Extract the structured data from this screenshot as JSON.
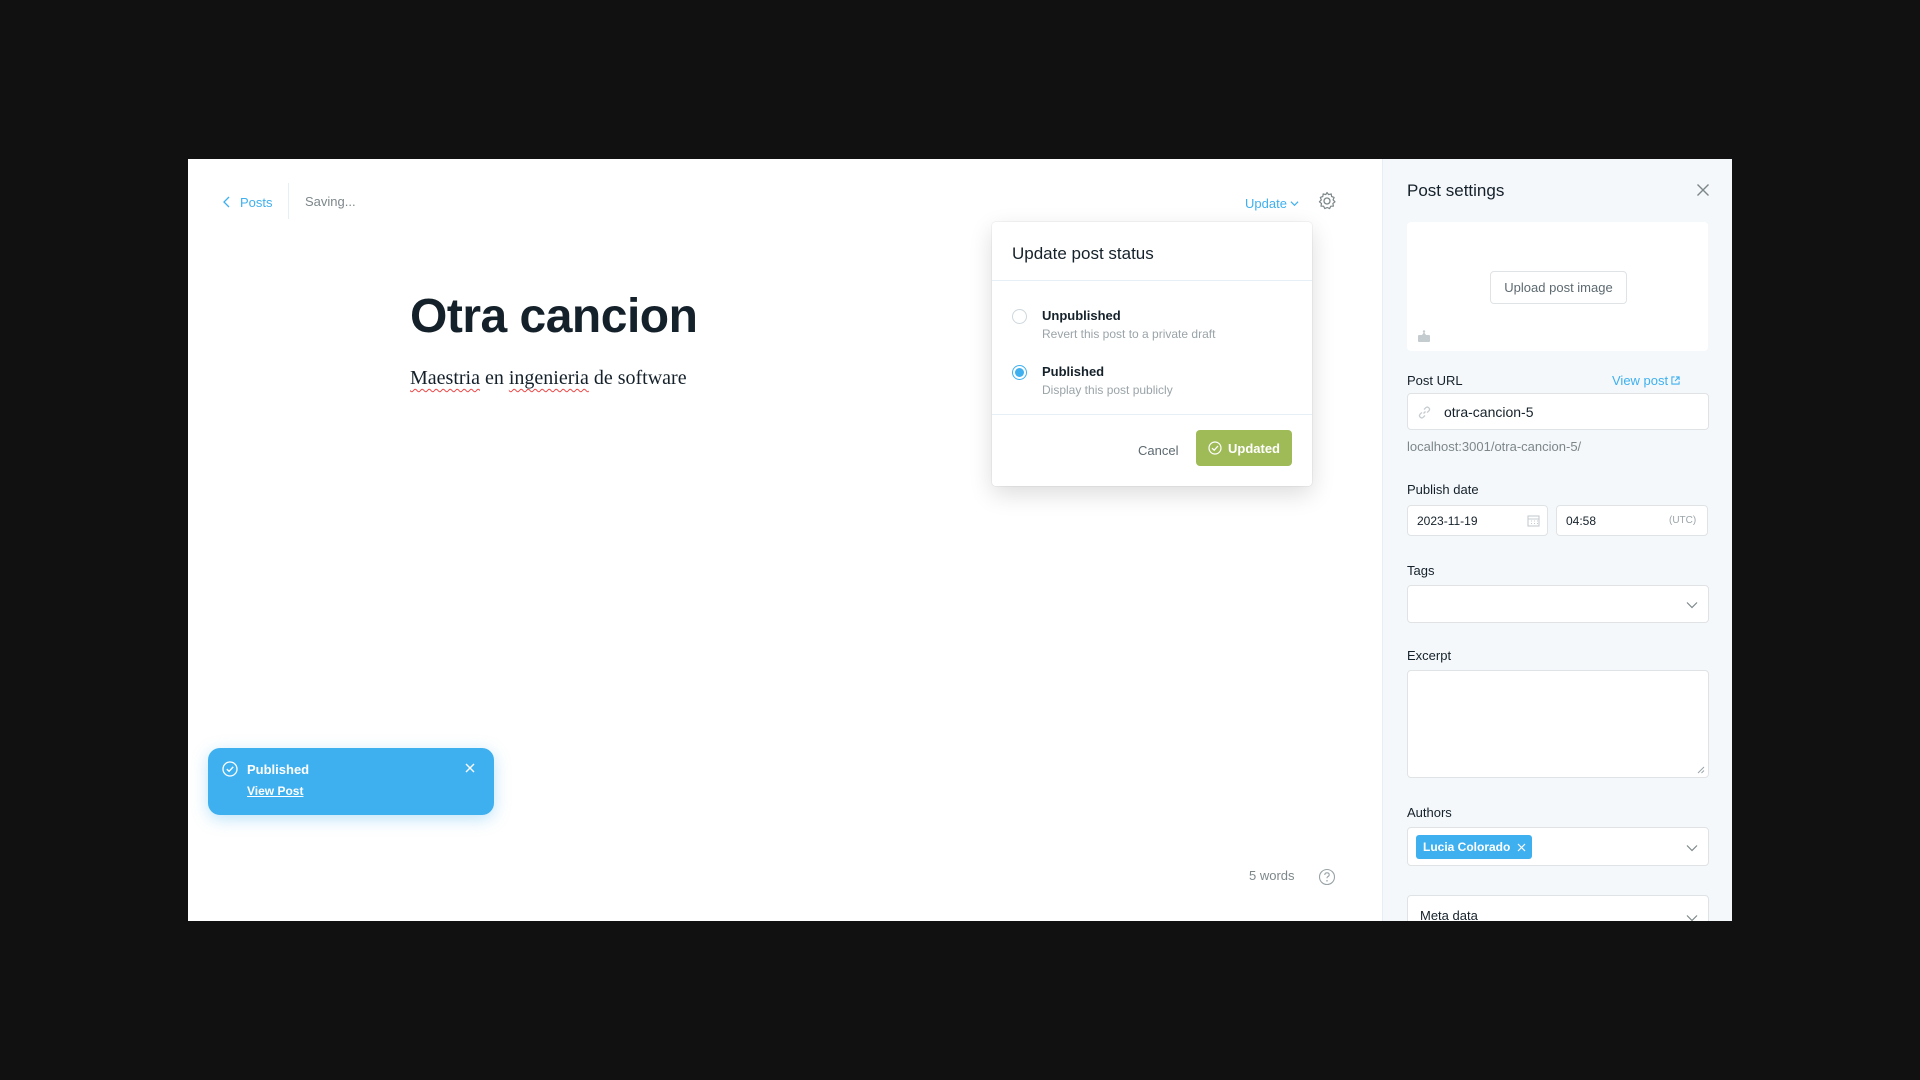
{
  "editor": {
    "back_label": "Posts",
    "status_text": "Saving...",
    "update_label": "Update",
    "title": "Otra cancion",
    "body_words": [
      "Maestria",
      "en",
      "ingenieria",
      "de",
      "software"
    ],
    "word_count": "5 words"
  },
  "popover": {
    "title": "Update post status",
    "options": [
      {
        "label": "Unpublished",
        "description": "Revert this post to a private draft",
        "selected": false
      },
      {
        "label": "Published",
        "description": "Display this post publicly",
        "selected": true
      }
    ],
    "cancel_label": "Cancel",
    "confirm_label": "Updated"
  },
  "toast": {
    "label": "Published",
    "link_label": "View Post"
  },
  "settings": {
    "title": "Post settings",
    "upload_label": "Upload post image",
    "url_label": "Post URL",
    "view_post_label": "View post",
    "slug": "otra-cancion-5",
    "url_help": "localhost:3001/otra-cancion-5/",
    "publish_date_label": "Publish date",
    "date": "2023-11-19",
    "time": "04:58",
    "timezone": "(UTC)",
    "tags_label": "Tags",
    "excerpt_label": "Excerpt",
    "authors_label": "Authors",
    "author": "Lucia Colorado",
    "meta_label": "Meta data"
  },
  "colors": {
    "accent": "#3eb0ef",
    "success": "#9fbb58",
    "backdrop": "#111111"
  },
  "icons": [
    "chevron-left-icon",
    "chevron-down-icon",
    "gear-icon",
    "check-circle-icon",
    "close-icon",
    "question-icon",
    "image-icon",
    "link-icon",
    "external-link-icon",
    "calendar-icon"
  ]
}
